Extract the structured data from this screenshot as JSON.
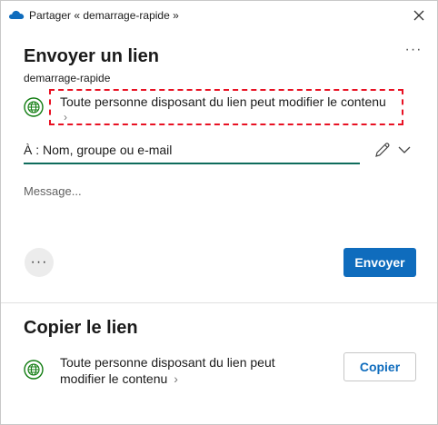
{
  "window": {
    "title": "Partager « demarrage-rapide »"
  },
  "send": {
    "heading": "Envoyer un lien",
    "more_label": "···",
    "filename": "demarrage-rapide",
    "permission_text": "Toute personne disposant du lien peut modifier le contenu",
    "permission_chevron": "›",
    "to_placeholder": "À : Nom, groupe ou e-mail",
    "message_placeholder": "Message...",
    "options_label": "···",
    "send_button": "Envoyer"
  },
  "copy": {
    "heading": "Copier le lien",
    "permission_text": "Toute personne disposant du lien peut modifier le contenu",
    "permission_chevron": "›",
    "copy_button": "Copier"
  },
  "colors": {
    "accent": "#0f6cbd",
    "field_underline": "#0f6c5c",
    "globe": "#107c10",
    "highlight_dash": "#e81123"
  },
  "icons": [
    "onedrive-cloud-icon",
    "close-icon",
    "more-horizontal-icon",
    "globe-icon",
    "chevron-right-icon",
    "pencil-icon",
    "chevron-down-icon"
  ]
}
